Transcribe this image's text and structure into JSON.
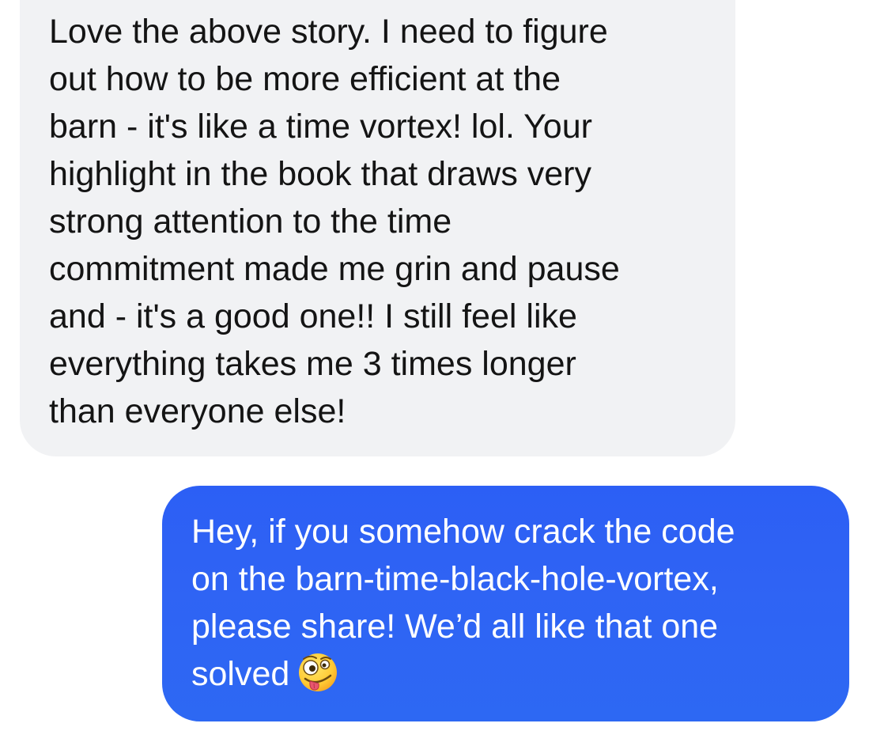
{
  "conversation": {
    "messages": [
      {
        "direction": "received",
        "text": "Love the above story. I need to figure\nout how to be more efficient at the\nbarn - it's like a time vortex! lol. Your\nhighlight in the book that draws very\nstrong attention to the time\ncommitment made me grin and pause\nand - it's a good one!! I still feel like\neverything takes me 3 times longer\nthan everyone else!"
      },
      {
        "direction": "sent",
        "text": "Hey, if you somehow crack the code\non the barn-time-black-hole-vortex,\nplease share! We’d all like that one\nsolved",
        "emoji": "zany-face-emoji"
      }
    ]
  },
  "colors": {
    "received_bubble": "#f1f2f4",
    "received_text": "#141414",
    "sent_bubble": "#2f63f4",
    "sent_text": "#ffffff"
  }
}
